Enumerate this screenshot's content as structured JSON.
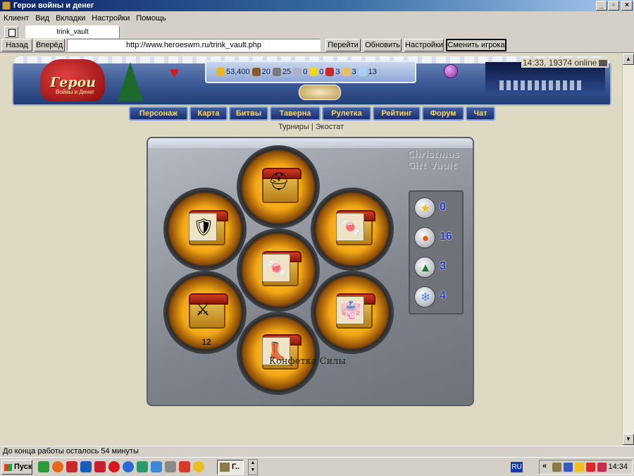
{
  "window": {
    "title": "Герои войны и денег"
  },
  "menu": [
    "Клиент",
    "Вид",
    "Вкладки",
    "Настройки",
    "Помощь"
  ],
  "tab": {
    "label": "trink_vault"
  },
  "nav": {
    "back": "Назад",
    "forward": "Вперёд",
    "url": "http://www.heroeswm.ru/trink_vault.php",
    "go": "Перейти",
    "refresh": "Обновить",
    "settings": "Настройки",
    "switch_player": "Сменить игрока"
  },
  "header": {
    "logo": "Герои",
    "logo_sub": "Войны и Денег",
    "online": "14:33, 19374 online",
    "resources": [
      {
        "name": "gold-icon",
        "value": "53,400",
        "color": "#e8b820"
      },
      {
        "name": "wood-icon",
        "value": "20",
        "color": "#8a5a2a"
      },
      {
        "name": "ore-icon",
        "value": "25",
        "color": "#7a7a7a"
      },
      {
        "name": "mercury-icon",
        "value": "0",
        "color": "#b0b0c8"
      },
      {
        "name": "sulfur-icon",
        "value": "0",
        "color": "#f0d820"
      },
      {
        "name": "crystal-icon",
        "value": "3",
        "color": "#d02828"
      },
      {
        "name": "gems-icon",
        "value": "3",
        "color": "#e8c060"
      },
      {
        "name": "diamond-icon",
        "value": "13",
        "color": "#a8d0f0"
      }
    ]
  },
  "main_nav": [
    "Персонаж",
    "Карта",
    "Битвы",
    "Таверна",
    "Рулетка",
    "Рейтинг",
    "Форум",
    "Чат"
  ],
  "subnav": {
    "tournaments": "Турниры",
    "separator": "|",
    "ecostat": "Экостат"
  },
  "vault": {
    "title_line1": "Christmas",
    "title_line2": "Gift Vault",
    "stats": [
      {
        "icon": "star-icon",
        "glyph": "★",
        "color": "#f0c020",
        "value": "0"
      },
      {
        "icon": "lantern-icon",
        "glyph": "●",
        "color": "#e85a10",
        "value": "16"
      },
      {
        "icon": "tree-icon",
        "glyph": "▲",
        "color": "#1e7a2a",
        "value": "3"
      },
      {
        "icon": "snowflake-icon",
        "glyph": "❄",
        "color": "#4a8ae8",
        "value": "4"
      }
    ],
    "slots": [
      {
        "name": "helmet",
        "glyph": "⛑",
        "count": ""
      },
      {
        "name": "armor",
        "glyph": "🛡",
        "count": ""
      },
      {
        "name": "candy",
        "glyph": "🍬",
        "count": ""
      },
      {
        "name": "candy-center",
        "glyph": "🍬",
        "count": ""
      },
      {
        "name": "swords",
        "glyph": "⚔",
        "count": "12"
      },
      {
        "name": "robe",
        "glyph": "👘",
        "count": ""
      },
      {
        "name": "boots",
        "glyph": "👢",
        "count": ""
      }
    ],
    "tooltip": "Конфетка Силы"
  },
  "status": "До конца работы осталось 54 минуты",
  "taskbar": {
    "start": "Пуск",
    "task": "Г..",
    "lang": "RU",
    "clock": "14:34"
  }
}
